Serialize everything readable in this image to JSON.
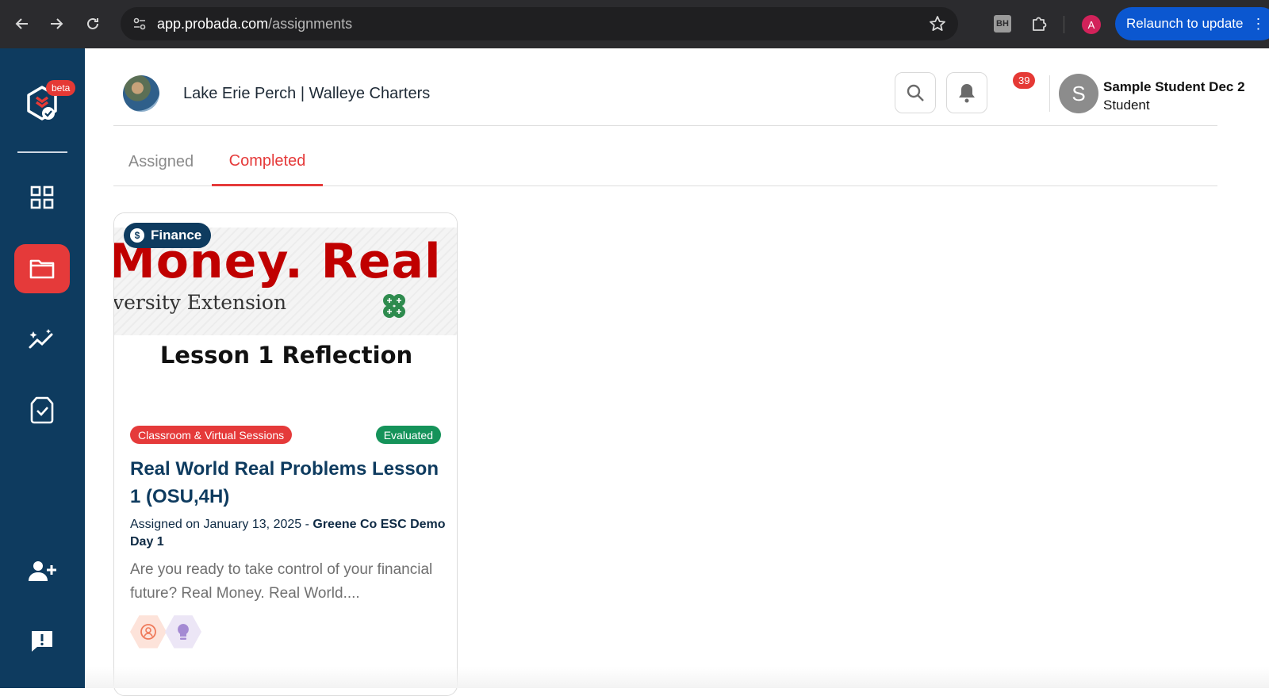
{
  "browser": {
    "url_host": "app.probada.com",
    "url_path": "/assignments",
    "extension_label": "BH",
    "profile_initial": "A",
    "relaunch_label": "Relaunch to update",
    "relaunch_dots": "⋮"
  },
  "sidebar": {
    "beta_label": "beta",
    "items": [
      "dashboard",
      "assignments",
      "insights",
      "tasks",
      "add-user",
      "feedback"
    ],
    "active_item": "assignments"
  },
  "header": {
    "org_name": "Lake Erie Perch | Walleye Charters",
    "notification_count": "39",
    "user_initial": "S",
    "user_name": "Sample Student Dec 2",
    "user_role": "Student"
  },
  "tabs": {
    "assigned": "Assigned",
    "completed": "Completed",
    "active": "completed"
  },
  "card": {
    "category": "Finance",
    "thumb_banner_big": "Money. Real W",
    "thumb_banner_small": "versity Extension",
    "thumb_title": "Lesson 1 Reflection",
    "tag_session": "Classroom & Virtual Sessions",
    "tag_status": "Evaluated",
    "title": "Real World Real Problems Lesson 1 (OSU,4H)",
    "assigned_prefix": "Assigned on January 13, 2025 - ",
    "assigned_by": "Greene Co ESC Demo Day 1",
    "description": "Are you ready to take control of your financial future? Real Money. Real World....",
    "skill_icons": [
      "collaboration-icon",
      "lightbulb-icon"
    ]
  },
  "colors": {
    "sidebar_bg": "#0e3b5f",
    "accent_red": "#e53a3a",
    "status_green": "#15935a",
    "relaunch_blue": "#0b57d0"
  }
}
